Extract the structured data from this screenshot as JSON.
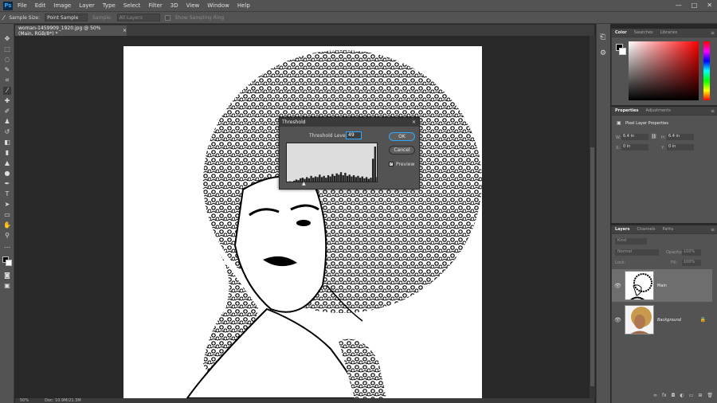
{
  "app": {
    "logo": "Ps",
    "menu": [
      "File",
      "Edit",
      "Image",
      "Layer",
      "Type",
      "Select",
      "Filter",
      "3D",
      "View",
      "Window",
      "Help"
    ],
    "window_controls": [
      "—",
      "□",
      "✕"
    ]
  },
  "options": {
    "sample_size_label": "Sample Size:",
    "sample_size_value": "Point Sample",
    "sample_label": "Sample:",
    "sample_value": "All Layers",
    "show_ring": "Show Sampling Ring"
  },
  "document": {
    "tab_title": "woman-1459909_1920.jpg @ 50% (Main, RGB/8*) *",
    "tab_close": "×"
  },
  "status": {
    "zoom": "50%",
    "doc": "Doc: 10.9M/21.3M"
  },
  "dialog": {
    "title": "Threshold",
    "close": "×",
    "level_label": "Threshold Level:",
    "level_value": "49",
    "ok": "OK",
    "cancel": "Cancel",
    "preview": "Preview",
    "histogram": [
      2,
      3,
      2,
      4,
      6,
      5,
      8,
      9,
      7,
      10,
      8,
      12,
      9,
      11,
      10,
      14,
      10,
      12,
      9,
      13,
      11,
      15,
      12,
      16,
      14,
      18,
      13,
      17,
      12,
      14,
      11,
      13,
      10,
      12,
      9,
      11,
      8,
      10,
      7,
      9,
      40,
      60,
      10
    ]
  },
  "color_panel": {
    "tabs": [
      "Color",
      "Swatches",
      "Libraries"
    ]
  },
  "properties": {
    "tabs": [
      "Properties",
      "Adjustments"
    ],
    "title": "Pixel Layer Properties",
    "w_label": "W:",
    "w_value": "6.4 in",
    "h_label": "H:",
    "h_value": "6.4 in",
    "x_label": "X:",
    "x_value": "0 in",
    "y_label": "Y:",
    "y_value": "0 in"
  },
  "layers": {
    "tabs": [
      "Layers",
      "Channels",
      "Paths"
    ],
    "kind": "Kind",
    "blend": "Normal",
    "opacity_label": "Opacity:",
    "opacity_value": "100%",
    "lock_label": "Lock:",
    "fill_label": "Fill:",
    "fill_value": "100%",
    "items": [
      {
        "name": "Main"
      },
      {
        "name": "Background"
      }
    ]
  },
  "colors": {
    "accent": "#31a8ff",
    "panel": "#535353",
    "dark": "#282828"
  }
}
